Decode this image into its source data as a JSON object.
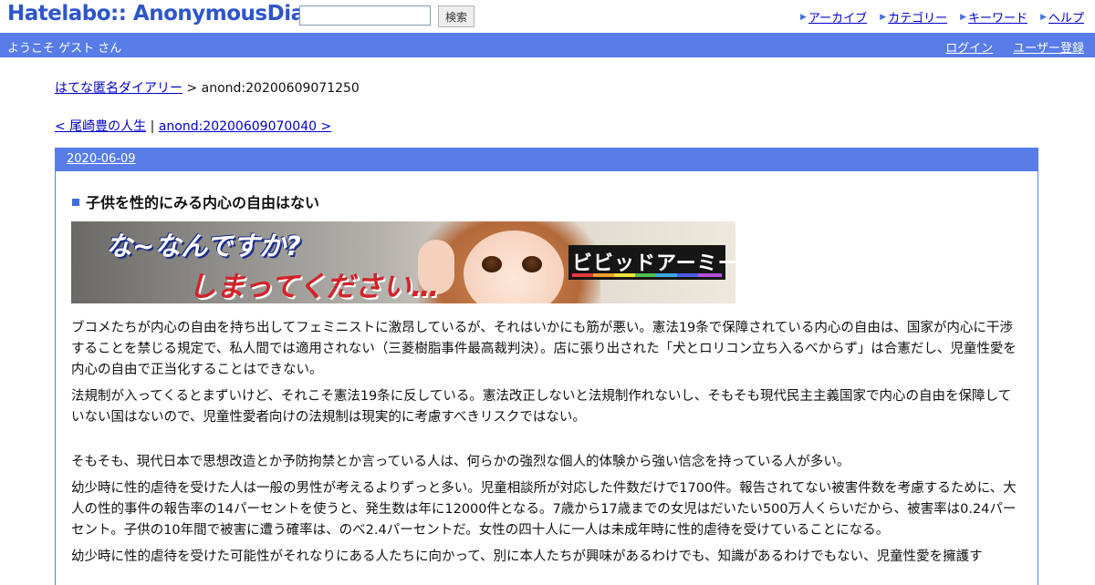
{
  "header": {
    "logo": "Hatelabo:: AnonymousDiary",
    "search": {
      "value": "",
      "button": "検索"
    },
    "nav": [
      "アーカイブ",
      "カテゴリー",
      "キーワード",
      "ヘルプ"
    ]
  },
  "userbar": {
    "welcome": "ようこそ ゲスト さん",
    "login": "ログイン",
    "register": "ユーザー登録"
  },
  "breadcrumb": {
    "home": "はてな匿名ダイアリー",
    "separator": ">",
    "current": "anond:20200609071250"
  },
  "pager": {
    "prev": "< 尾崎豊の人生",
    "separator": "|",
    "next": "anond:20200609070040 >"
  },
  "section": {
    "date": "2020-06-09",
    "title": "子供を性的にみる内心の自由はない"
  },
  "banner": {
    "line1": "な~なんですか?",
    "line2": "しまってください…",
    "logo": "ビビッドアーミー"
  },
  "paragraphs": [
    "ブコメたちが内心の自由を持ち出してフェミニストに激昂しているが、それはいかにも筋が悪い。憲法19条で保障されている内心の自由は、国家が内心に干渉することを禁じる規定で、私人間では適用されない（三菱樹脂事件最高裁判決）。店に張り出された「犬とロリコン立ち入るべからず」は合憲だし、児童性愛を内心の自由で正当化することはできない。",
    "法規制が入ってくるとまずいけど、それこそ憲法19条に反している。憲法改正しないと法規制作れないし、そもそも現代民主主義国家で内心の自由を保障していない国はないので、児童性愛者向けの法規制は現実的に考慮すべきリスクではない。",
    "そもそも、現代日本で思想改造とか予防拘禁とか言っている人は、何らかの強烈な個人的体験から強い信念を持っている人が多い。",
    "幼少時に性的虐待を受けた人は一般の男性が考えるよりずっと多い。児童相談所が対応した件数だけで1700件。報告されてない被害件数を考慮するために、大人の性的事件の報告率の14パーセントを使うと、発生数は年に12000件となる。7歳から17歳までの女児はだいたい500万人くらいだから、被害率は0.24パーセント。子供の10年間で被害に遭う確率は、のべ2.4パーセントだ。女性の四十人に一人は未成年時に性的虐待を受けていることになる。",
    "幼少時に性的虐待を受けた可能性がそれなりにある人たちに向かって、別に本人たちが興味があるわけでも、知識があるわけでもない、児童性愛を擁護す"
  ]
}
